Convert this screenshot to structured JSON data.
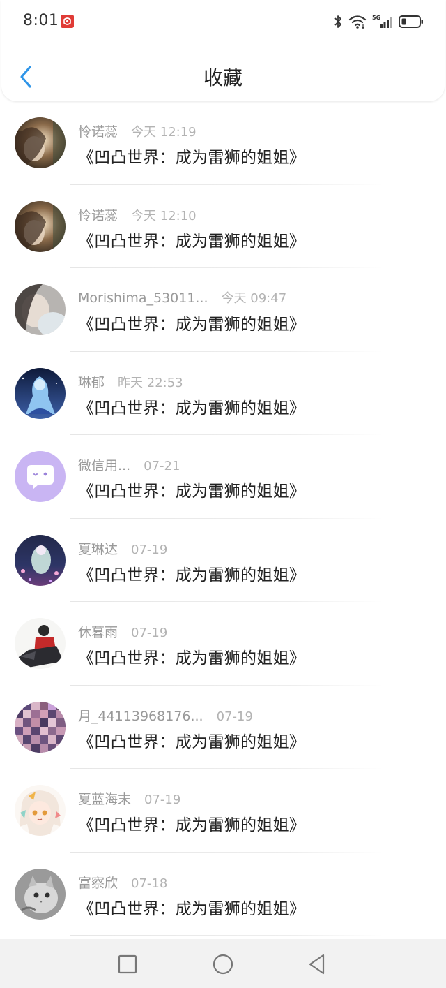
{
  "status_bar": {
    "time": "8:01"
  },
  "header": {
    "title": "收藏"
  },
  "items": [
    {
      "username": "怜诺蕊",
      "timestamp": "今天 12:19",
      "title": "《凹凸世界：成为雷狮的姐姐》",
      "avatar": "avatar-portrait-dark"
    },
    {
      "username": "怜诺蕊",
      "timestamp": "今天 12:10",
      "title": "《凹凸世界：成为雷狮的姐姐》",
      "avatar": "avatar-portrait-dark"
    },
    {
      "username": "Morishima_53011...",
      "timestamp": "今天 09:47",
      "title": "《凹凸世界：成为雷狮的姐姐》",
      "avatar": "avatar-portrait-grey"
    },
    {
      "username": "琳郁",
      "timestamp": "昨天 22:53",
      "title": "《凹凸世界：成为雷狮的姐姐》",
      "avatar": "avatar-anime-blue"
    },
    {
      "username": "微信用...",
      "timestamp": "07-21",
      "title": "《凹凸世界：成为雷狮的姐姐》",
      "avatar": "wechat-default-icon"
    },
    {
      "username": "夏琳达",
      "timestamp": "07-19",
      "title": "《凹凸世界：成为雷狮的姐姐》",
      "avatar": "avatar-anime-night"
    },
    {
      "username": "休暮雨",
      "timestamp": "07-19",
      "title": "《凹凸世界：成为雷狮的姐姐》",
      "avatar": "avatar-anime-red"
    },
    {
      "username": "月_44113968176...",
      "timestamp": "07-19",
      "title": "《凹凸世界：成为雷狮的姐姐》",
      "avatar": "avatar-mosaic"
    },
    {
      "username": "夏蓝海末",
      "timestamp": "07-19",
      "title": "《凹凸世界：成为雷狮的姐姐》",
      "avatar": "avatar-anime-girl"
    },
    {
      "username": "富察欣",
      "timestamp": "07-18",
      "title": "《凹凸世界：成为雷狮的姐姐》",
      "avatar": "avatar-cat"
    }
  ],
  "colors": {
    "accent": "#2f95e8",
    "username": "#999999",
    "timestamp": "#b3b3b3",
    "title": "#222222",
    "wechat_avatar_bg": "#c9b5f3",
    "nav_bg": "#f2f2f2"
  }
}
